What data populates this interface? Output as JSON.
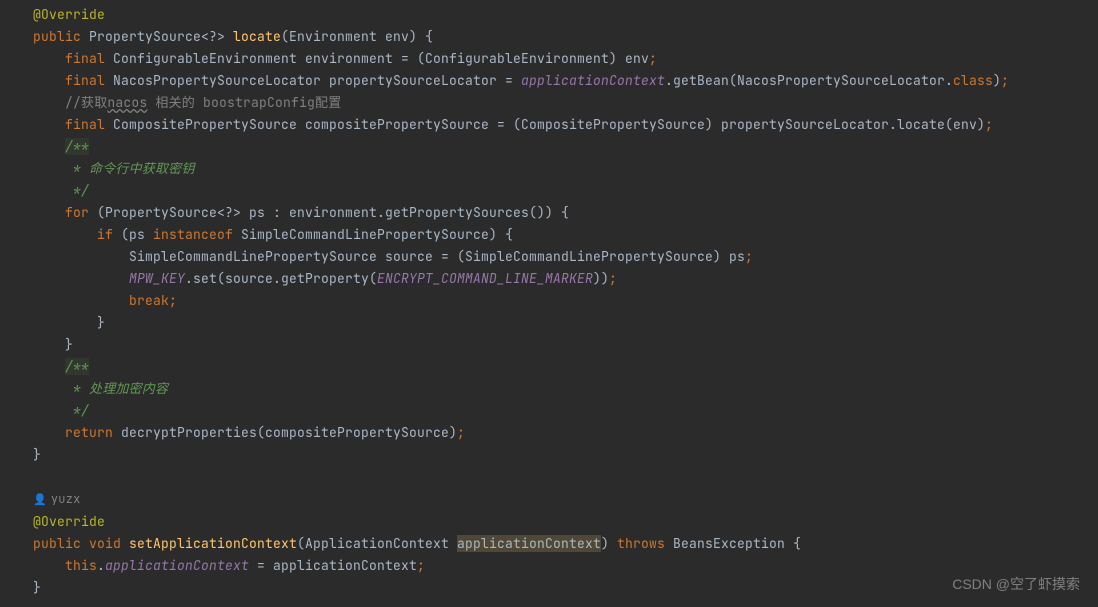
{
  "line1_annot": "@Override",
  "line2_public": "public",
  "line2_ret": "PropertySource<?>",
  "line2_method": "locate",
  "line2_params": "(Environment env) {",
  "line3_final": "final",
  "line3_type": "ConfigurableEnvironment environment = (ConfigurableEnvironment) env",
  "line4_final": "final",
  "line4_type": "NacosPropertySourceLocator propertySourceLocator = ",
  "line4_field": "applicationContext",
  "line4_rest": ".getBean(NacosPropertySourceLocator.",
  "line4_class": "class",
  "line4_end": ")",
  "line5_comment_a": "//获取",
  "line5_comment_b": "nacos",
  "line5_comment_c": " 相关的 boostrapConfig配置",
  "line6_final": "final",
  "line6_type": "CompositePropertySource compositePropertySource = (CompositePropertySource) propertySourceLocator.locate(env)",
  "line7_jdoc": "/**",
  "line8_jdoc": " * 命令行中获取密钥",
  "line9_jdoc": " */",
  "line10_for": "for",
  "line10_rest": " (PropertySource<?> ps : environment.getPropertySources()) {",
  "line11_if": "if",
  "line11_a": " (ps ",
  "line11_inst": "instanceof",
  "line11_b": " SimpleCommandLinePropertySource) {",
  "line12": "SimpleCommandLinePropertySource source = (SimpleCommandLinePropertySource) ps",
  "line13_field": "MPW_KEY",
  "line13_a": ".set(source.getProperty(",
  "line13_const": "ENCRYPT_COMMAND_LINE_MARKER",
  "line13_b": "))",
  "line14_break": "break",
  "line15_brace": "}",
  "line16_brace": "}",
  "line17_jdoc": "/**",
  "line18_jdoc": " * 处理加密内容",
  "line19_jdoc": " */",
  "line20_return": "return",
  "line20_rest": " decryptProperties(compositePropertySource)",
  "line21_brace": "}",
  "user": "yuzx",
  "line22_annot": "@Override",
  "line23_public": "public",
  "line23_void": "void",
  "line23_method": "setApplicationContext",
  "line23_a": "(ApplicationContext ",
  "line23_param": "applicationContext",
  "line23_b": ") ",
  "line23_throws": "throws",
  "line23_c": " BeansException {",
  "line24_this": "this",
  "line24_a": ".",
  "line24_field": "applicationContext",
  "line24_b": " = applicationContext",
  "line25_brace": "}",
  "watermark": "CSDN @空了虾摸索"
}
